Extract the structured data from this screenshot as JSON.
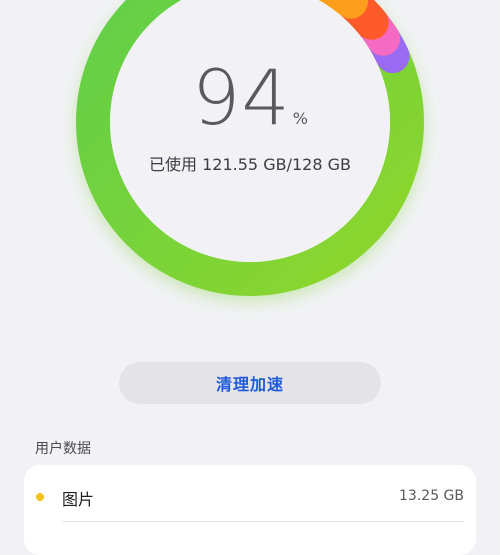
{
  "storage": {
    "percent": "94",
    "percent_sign": "%",
    "used_label": "已使用",
    "used_value": "121.55 GB/128 GB",
    "ring_segments": [
      {
        "name": "green-main",
        "color": "#74d23a",
        "fraction": 0.82
      },
      {
        "name": "orange",
        "color": "#ff9e1f",
        "fraction": 0.05
      },
      {
        "name": "red-orange",
        "color": "#ff5a2a",
        "fraction": 0.03
      },
      {
        "name": "pink",
        "color": "#f56ac3",
        "fraction": 0.02
      },
      {
        "name": "purple",
        "color": "#9a6bf2",
        "fraction": 0.02
      }
    ]
  },
  "actions": {
    "clean_label": "清理加速"
  },
  "user_data": {
    "title": "用户数据",
    "items": [
      {
        "label": "图片",
        "value": "13.25 GB",
        "dot_color": "#f6c21c"
      }
    ]
  },
  "colors": {
    "accent_blue": "#1f5bd6",
    "background": "#f2f2f6"
  }
}
